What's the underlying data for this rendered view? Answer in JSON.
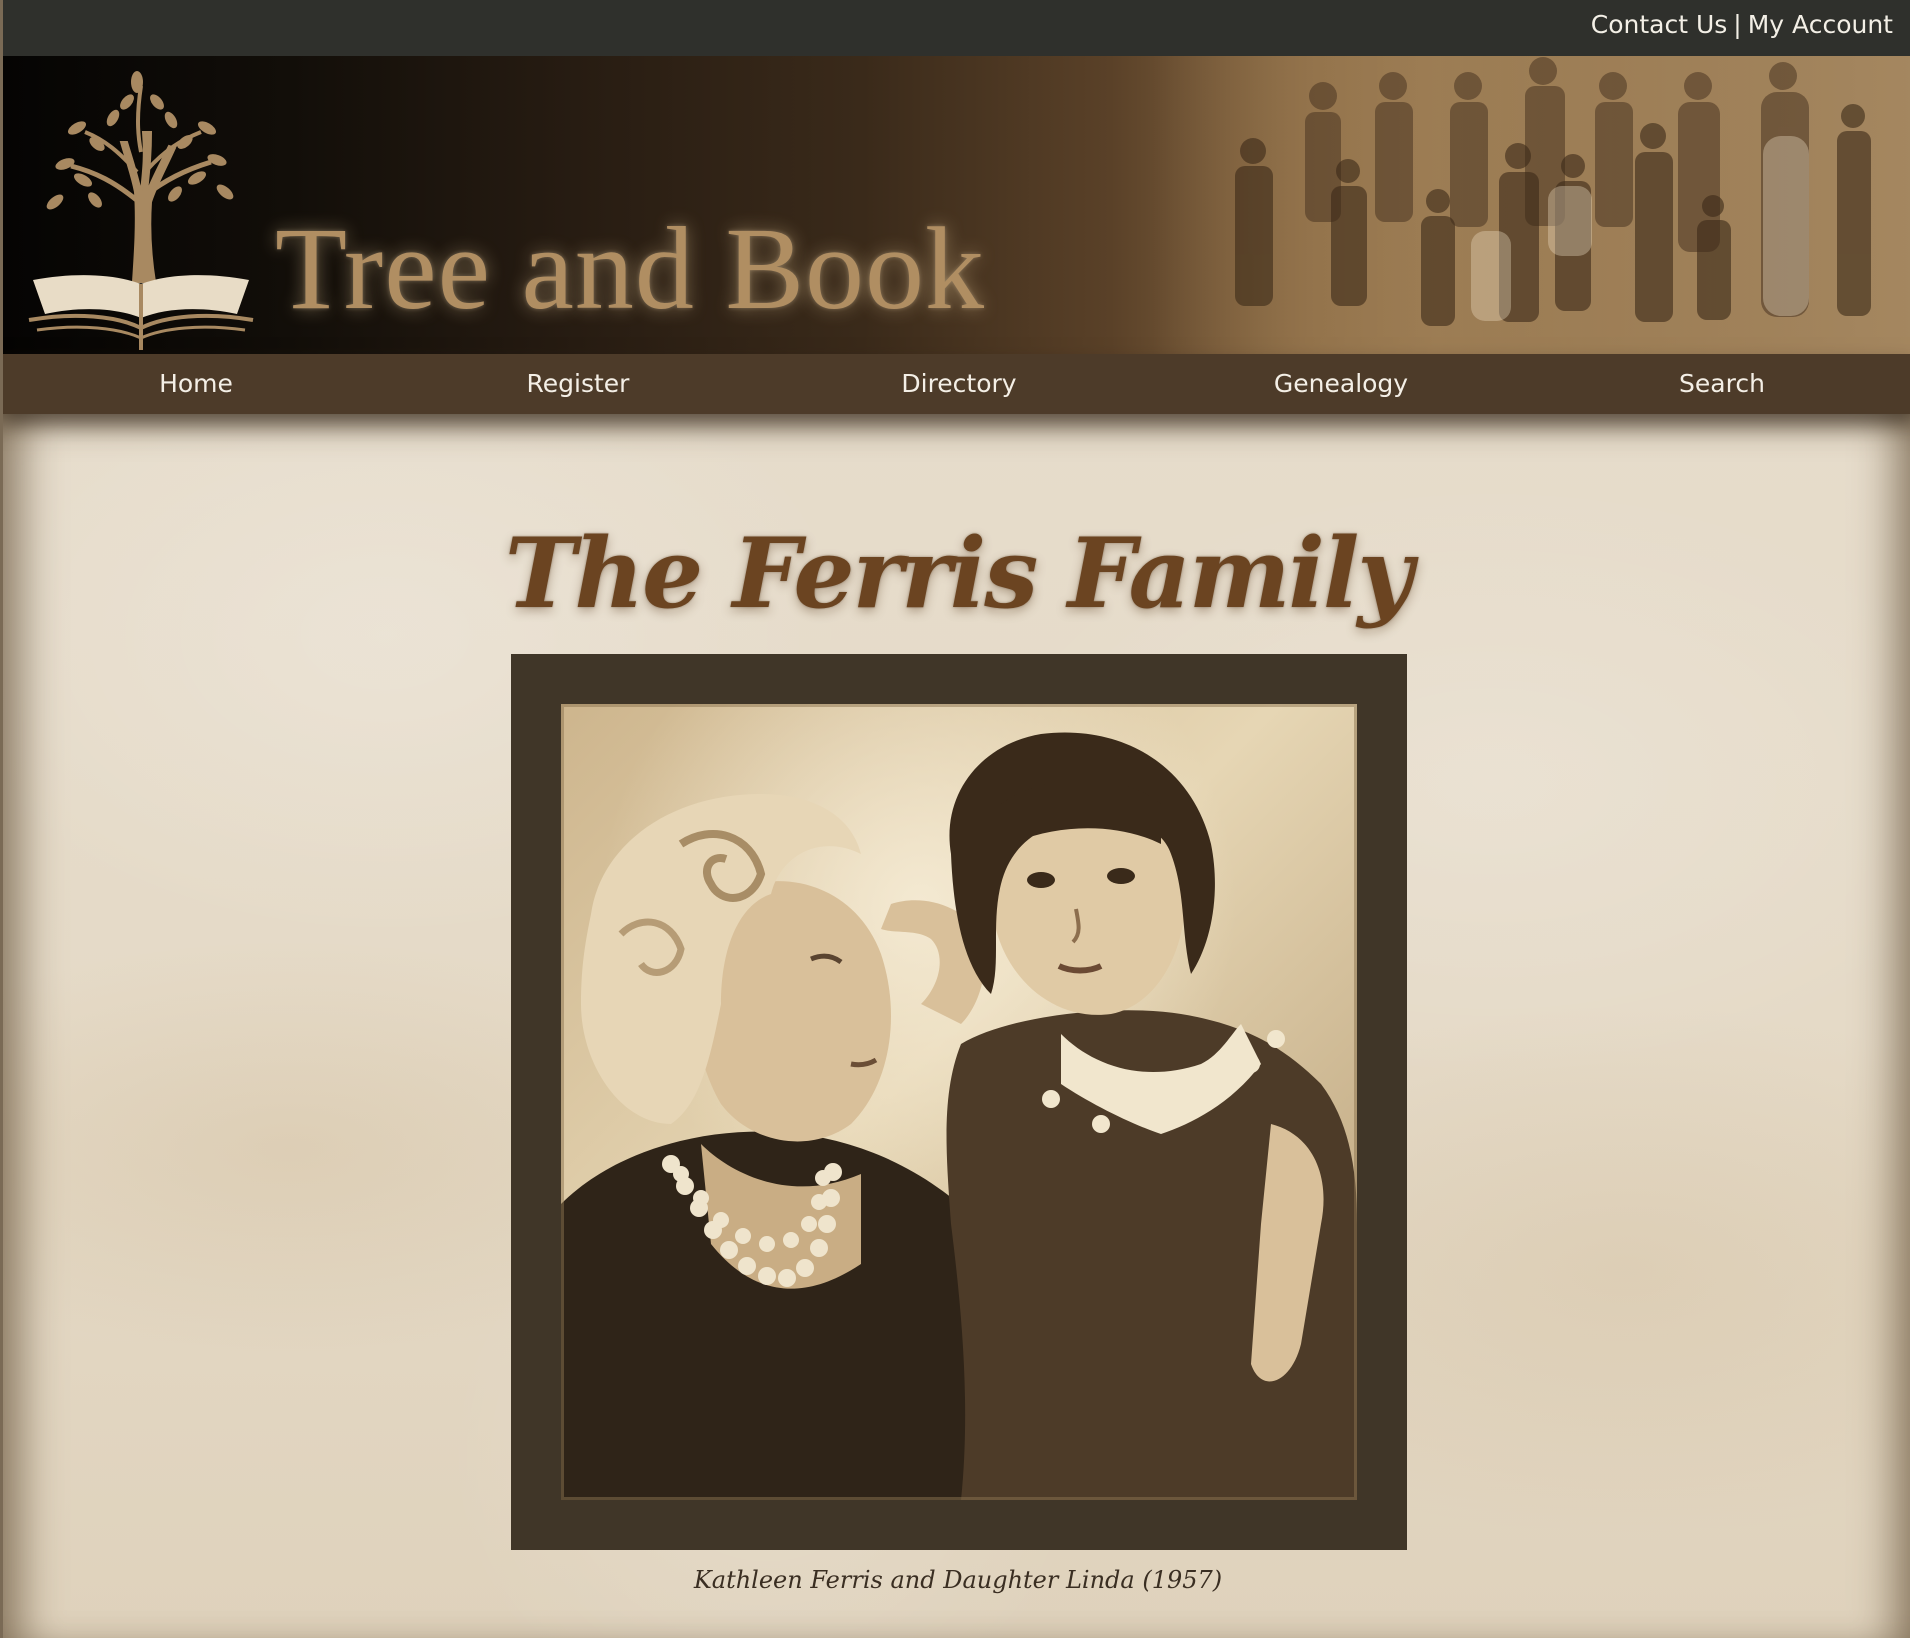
{
  "utility": {
    "contact_label": "Contact Us",
    "separator": "|",
    "account_label": "My Account"
  },
  "header": {
    "site_title": "Tree and Book",
    "logo_icon": "tree-on-open-book-icon",
    "banner_image": "vintage-family-group-photo"
  },
  "nav": {
    "items": [
      {
        "label": "Home"
      },
      {
        "label": "Register"
      },
      {
        "label": "Directory"
      },
      {
        "label": "Genealogy"
      },
      {
        "label": "Search"
      }
    ]
  },
  "main": {
    "heading": "The Ferris Family",
    "photo": "sepia-portrait-mother-and-daughter",
    "caption": "Kathleen Ferris and Daughter Linda (1957)"
  },
  "colors": {
    "utility_bar": "#2f302c",
    "nav_bar": "#4d3b29",
    "heading": "#6b4421",
    "frame": "#403628",
    "background": "#e6dccb"
  }
}
